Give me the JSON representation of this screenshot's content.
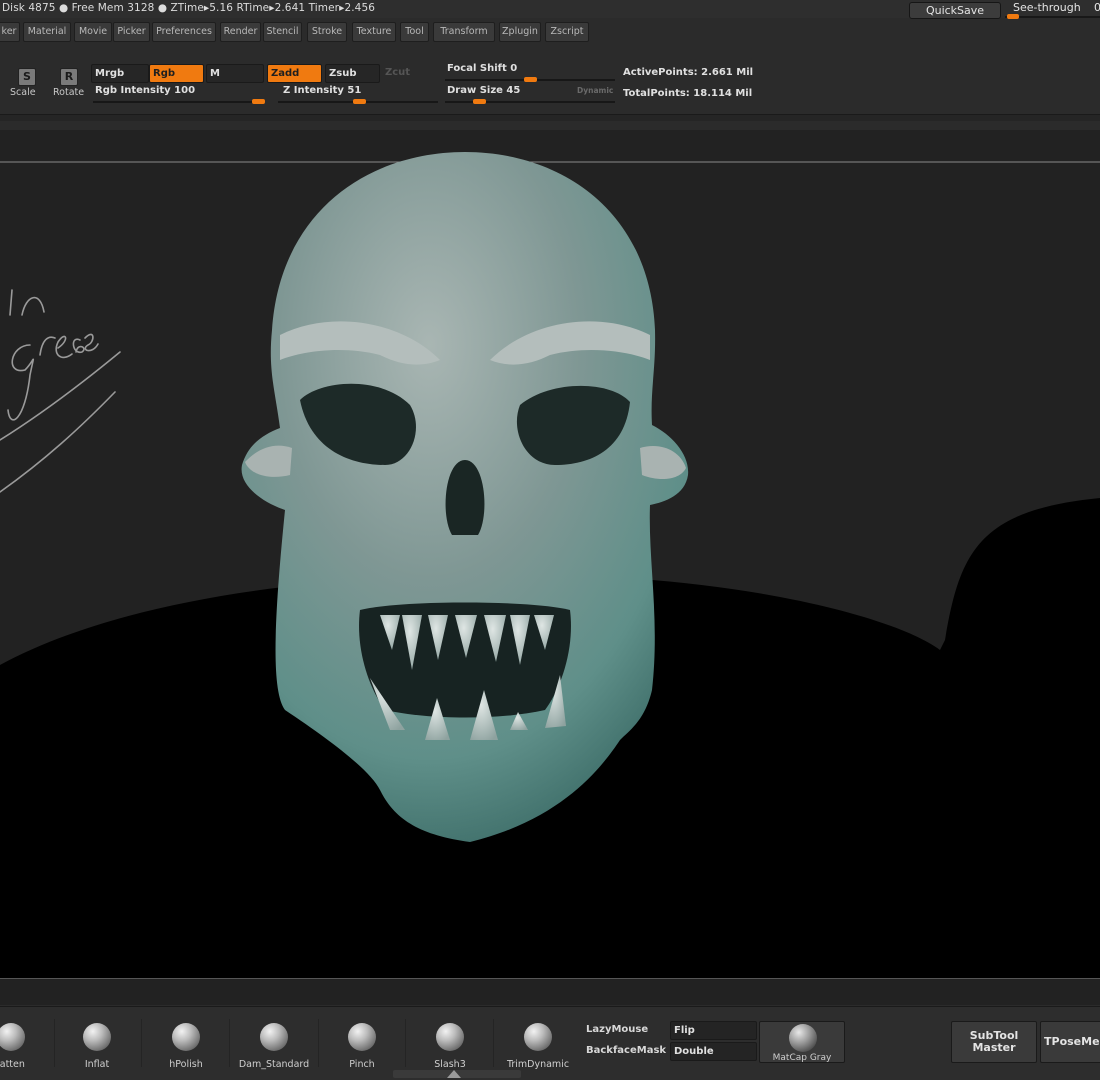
{
  "status": {
    "text": "Disk 4875 ● Free Mem 3128 ● ZTime▸5.16 RTime▸2.641 Timer▸2.456",
    "quicksave_label": "QuickSave",
    "see_through_label": "See-through",
    "see_through_value": "0"
  },
  "menu": {
    "items": [
      "ker",
      "Material",
      "Movie",
      "Picker",
      "Preferences",
      "Render",
      "Stencil",
      "Stroke",
      "Texture",
      "Tool",
      "Transform",
      "Zplugin",
      "Zscript"
    ]
  },
  "toolbar": {
    "scale_label": "Scale",
    "scale_icon_glyph": "S",
    "rotate_label": "Rotate",
    "rotate_icon_glyph": "R",
    "mrgb": "Mrgb",
    "rgb": "Rgb",
    "m": "M",
    "zadd": "Zadd",
    "zsub": "Zsub",
    "zcut": "Zcut",
    "rgb_intensity_label": "Rgb Intensity 100",
    "rgb_intensity_value": 100,
    "z_intensity_label": "Z Intensity 51",
    "z_intensity_value": 51,
    "focal_shift_label": "Focal Shift 0",
    "focal_shift_value": 0,
    "draw_size_label": "Draw Size 45",
    "draw_size_value": 45,
    "dynamic_label": "Dynamic",
    "active_points": "ActivePoints: 2.661 Mil",
    "total_points": "TotalPoints: 18.114 Mil",
    "accent_color": "#f07a10"
  },
  "canvas": {
    "handwritten_note": "in progress"
  },
  "shelf": {
    "brushes": [
      "latten",
      "Inflat",
      "hPolish",
      "Dam_Standard",
      "Pinch",
      "Slash3",
      "TrimDynamic"
    ],
    "lazymouse_label": "LazyMouse",
    "lazymouse_value": "Flip",
    "backfacemask_label": "BackfaceMask",
    "backfacemask_value": "Double",
    "matcap_label": "MatCap Gray",
    "subtool_master_line1": "SubTool",
    "subtool_master_line2": "Master",
    "tpose_label": "TPoseMesh"
  }
}
